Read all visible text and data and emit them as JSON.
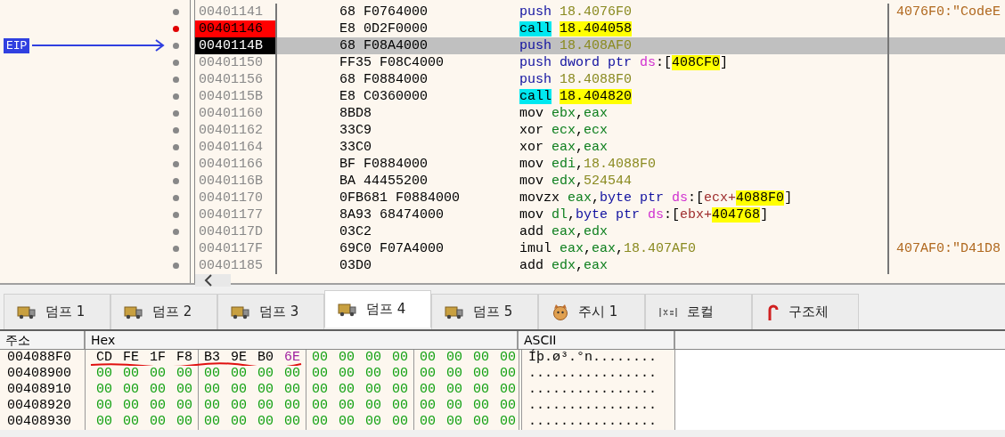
{
  "disassembly": {
    "eip_label": "EIP",
    "rows": [
      {
        "address": "00401141",
        "breakpoint": false,
        "current": false,
        "bytes": "68 F0764000",
        "instruction": [
          {
            "text": "push ",
            "kind": "stack"
          },
          {
            "text": "18.4076F0",
            "kind": "num"
          }
        ],
        "comment": "4076F0:\"CodeE"
      },
      {
        "address": "00401146",
        "breakpoint": true,
        "current": false,
        "bytes": "E8 0D2F0000",
        "instruction": [
          {
            "text": "call",
            "kind": "call"
          },
          {
            "text": "18.404058",
            "kind": "addr"
          }
        ]
      },
      {
        "address": "0040114B",
        "breakpoint": false,
        "current": true,
        "bytes": "68 F08A4000",
        "instruction": [
          {
            "text": "push ",
            "kind": "stack"
          },
          {
            "text": "18.408AF0",
            "kind": "num"
          }
        ]
      },
      {
        "address": "00401150",
        "breakpoint": false,
        "current": false,
        "bytes": "FF35 F08C4000",
        "instruction": [
          {
            "text": "push ",
            "kind": "stack"
          },
          {
            "text": "dword ptr ",
            "kind": "ptr"
          },
          {
            "text": "ds",
            "kind": "seg"
          },
          {
            "text": ":[",
            "kind": "punct"
          },
          {
            "text": "408CF0",
            "kind": "addr"
          },
          {
            "text": "]",
            "kind": "punct"
          }
        ]
      },
      {
        "address": "00401156",
        "breakpoint": false,
        "current": false,
        "bytes": "68 F0884000",
        "instruction": [
          {
            "text": "push ",
            "kind": "stack"
          },
          {
            "text": "18.4088F0",
            "kind": "num"
          }
        ]
      },
      {
        "address": "0040115B",
        "breakpoint": false,
        "current": false,
        "bytes": "E8 C0360000",
        "instruction": [
          {
            "text": "call",
            "kind": "call"
          },
          {
            "text": "18.404820",
            "kind": "addr"
          }
        ]
      },
      {
        "address": "00401160",
        "breakpoint": false,
        "current": false,
        "bytes": "8BD8",
        "instruction": [
          {
            "text": "mov ",
            "kind": "mnem"
          },
          {
            "text": "ebx",
            "kind": "reg"
          },
          {
            "text": ",",
            "kind": "punct"
          },
          {
            "text": "eax",
            "kind": "reg"
          }
        ]
      },
      {
        "address": "00401162",
        "breakpoint": false,
        "current": false,
        "bytes": "33C9",
        "instruction": [
          {
            "text": "xor ",
            "kind": "mnem"
          },
          {
            "text": "ecx",
            "kind": "reg"
          },
          {
            "text": ",",
            "kind": "punct"
          },
          {
            "text": "ecx",
            "kind": "reg"
          }
        ]
      },
      {
        "address": "00401164",
        "breakpoint": false,
        "current": false,
        "bytes": "33C0",
        "instruction": [
          {
            "text": "xor ",
            "kind": "mnem"
          },
          {
            "text": "eax",
            "kind": "reg"
          },
          {
            "text": ",",
            "kind": "punct"
          },
          {
            "text": "eax",
            "kind": "reg"
          }
        ]
      },
      {
        "address": "00401166",
        "breakpoint": false,
        "current": false,
        "bytes": "BF F0884000",
        "instruction": [
          {
            "text": "mov ",
            "kind": "mnem"
          },
          {
            "text": "edi",
            "kind": "reg"
          },
          {
            "text": ",",
            "kind": "punct"
          },
          {
            "text": "18.4088F0",
            "kind": "num"
          }
        ]
      },
      {
        "address": "0040116B",
        "breakpoint": false,
        "current": false,
        "bytes": "BA 44455200",
        "instruction": [
          {
            "text": "mov ",
            "kind": "mnem"
          },
          {
            "text": "edx",
            "kind": "reg"
          },
          {
            "text": ",",
            "kind": "punct"
          },
          {
            "text": "524544",
            "kind": "num"
          }
        ]
      },
      {
        "address": "00401170",
        "breakpoint": false,
        "current": false,
        "bytes": "0FB681 F0884000",
        "instruction": [
          {
            "text": "movzx ",
            "kind": "mnem"
          },
          {
            "text": "eax",
            "kind": "reg"
          },
          {
            "text": ",",
            "kind": "punct"
          },
          {
            "text": "byte ptr ",
            "kind": "ptr"
          },
          {
            "text": "ds",
            "kind": "seg"
          },
          {
            "text": ":[",
            "kind": "punct"
          },
          {
            "text": "ecx+",
            "kind": "memreg"
          },
          {
            "text": "4088F0",
            "kind": "addr"
          },
          {
            "text": "]",
            "kind": "punct"
          }
        ]
      },
      {
        "address": "00401177",
        "breakpoint": false,
        "current": false,
        "bytes": "8A93 68474000",
        "instruction": [
          {
            "text": "mov ",
            "kind": "mnem"
          },
          {
            "text": "dl",
            "kind": "reg"
          },
          {
            "text": ",",
            "kind": "punct"
          },
          {
            "text": "byte ptr ",
            "kind": "ptr"
          },
          {
            "text": "ds",
            "kind": "seg"
          },
          {
            "text": ":[",
            "kind": "punct"
          },
          {
            "text": "ebx+",
            "kind": "memreg"
          },
          {
            "text": "404768",
            "kind": "addr"
          },
          {
            "text": "]",
            "kind": "punct"
          }
        ]
      },
      {
        "address": "0040117D",
        "breakpoint": false,
        "current": false,
        "bytes": "03C2",
        "instruction": [
          {
            "text": "add ",
            "kind": "mnem"
          },
          {
            "text": "eax",
            "kind": "reg"
          },
          {
            "text": ",",
            "kind": "punct"
          },
          {
            "text": "edx",
            "kind": "reg"
          }
        ]
      },
      {
        "address": "0040117F",
        "breakpoint": false,
        "current": false,
        "bytes": "69C0 F07A4000",
        "instruction": [
          {
            "text": "imul ",
            "kind": "mnem"
          },
          {
            "text": "eax",
            "kind": "reg"
          },
          {
            "text": ",",
            "kind": "punct"
          },
          {
            "text": "eax",
            "kind": "reg"
          },
          {
            "text": ",",
            "kind": "punct"
          },
          {
            "text": "18.407AF0",
            "kind": "num"
          }
        ],
        "comment": "407AF0:\"D41D8"
      },
      {
        "address": "00401185",
        "breakpoint": false,
        "current": false,
        "bytes": "03D0",
        "instruction": [
          {
            "text": "add ",
            "kind": "mnem"
          },
          {
            "text": "edx",
            "kind": "reg"
          },
          {
            "text": ",",
            "kind": "punct"
          },
          {
            "text": "eax",
            "kind": "reg"
          }
        ]
      }
    ]
  },
  "tabs": [
    {
      "label": "덤프 1",
      "kind": "dump",
      "selected": false
    },
    {
      "label": "덤프 2",
      "kind": "dump",
      "selected": false
    },
    {
      "label": "덤프 3",
      "kind": "dump",
      "selected": false
    },
    {
      "label": "덤프 4",
      "kind": "dump",
      "selected": true
    },
    {
      "label": "덤프 5",
      "kind": "dump",
      "selected": false
    },
    {
      "label": "주시 1",
      "kind": "watch",
      "selected": false
    },
    {
      "label": "로컬",
      "kind": "locals",
      "selected": false
    },
    {
      "label": "구조체",
      "kind": "struct",
      "selected": false
    }
  ],
  "dump": {
    "columns": [
      "주소",
      "Hex",
      "ASCII"
    ],
    "annotation": {
      "kind": "underline"
    },
    "rows": [
      {
        "address": "004088F0",
        "ascii": "Íþ.ø³.°n........",
        "bytes": [
          {
            "text": "CD",
            "kind": "data"
          },
          {
            "text": "FE",
            "kind": "data"
          },
          {
            "text": "1F",
            "kind": "data"
          },
          {
            "text": "F8",
            "kind": "data"
          },
          {
            "text": "B3",
            "kind": "data"
          },
          {
            "text": "9E",
            "kind": "data"
          },
          {
            "text": "B0",
            "kind": "data"
          },
          {
            "text": "6E",
            "kind": "text"
          },
          {
            "text": "00",
            "kind": "zero"
          },
          {
            "text": "00",
            "kind": "zero"
          },
          {
            "text": "00",
            "kind": "zero"
          },
          {
            "text": "00",
            "kind": "zero"
          },
          {
            "text": "00",
            "kind": "zero"
          },
          {
            "text": "00",
            "kind": "zero"
          },
          {
            "text": "00",
            "kind": "zero"
          },
          {
            "text": "00",
            "kind": "zero"
          }
        ]
      },
      {
        "address": "00408900",
        "ascii": "................",
        "bytes": [
          {
            "text": "00",
            "kind": "zero"
          },
          {
            "text": "00",
            "kind": "zero"
          },
          {
            "text": "00",
            "kind": "zero"
          },
          {
            "text": "00",
            "kind": "zero"
          },
          {
            "text": "00",
            "kind": "zero"
          },
          {
            "text": "00",
            "kind": "zero"
          },
          {
            "text": "00",
            "kind": "zero"
          },
          {
            "text": "00",
            "kind": "zero"
          },
          {
            "text": "00",
            "kind": "zero"
          },
          {
            "text": "00",
            "kind": "zero"
          },
          {
            "text": "00",
            "kind": "zero"
          },
          {
            "text": "00",
            "kind": "zero"
          },
          {
            "text": "00",
            "kind": "zero"
          },
          {
            "text": "00",
            "kind": "zero"
          },
          {
            "text": "00",
            "kind": "zero"
          },
          {
            "text": "00",
            "kind": "zero"
          }
        ]
      },
      {
        "address": "00408910",
        "ascii": "................",
        "bytes": [
          {
            "text": "00",
            "kind": "zero"
          },
          {
            "text": "00",
            "kind": "zero"
          },
          {
            "text": "00",
            "kind": "zero"
          },
          {
            "text": "00",
            "kind": "zero"
          },
          {
            "text": "00",
            "kind": "zero"
          },
          {
            "text": "00",
            "kind": "zero"
          },
          {
            "text": "00",
            "kind": "zero"
          },
          {
            "text": "00",
            "kind": "zero"
          },
          {
            "text": "00",
            "kind": "zero"
          },
          {
            "text": "00",
            "kind": "zero"
          },
          {
            "text": "00",
            "kind": "zero"
          },
          {
            "text": "00",
            "kind": "zero"
          },
          {
            "text": "00",
            "kind": "zero"
          },
          {
            "text": "00",
            "kind": "zero"
          },
          {
            "text": "00",
            "kind": "zero"
          },
          {
            "text": "00",
            "kind": "zero"
          }
        ]
      },
      {
        "address": "00408920",
        "ascii": "................",
        "bytes": [
          {
            "text": "00",
            "kind": "zero"
          },
          {
            "text": "00",
            "kind": "zero"
          },
          {
            "text": "00",
            "kind": "zero"
          },
          {
            "text": "00",
            "kind": "zero"
          },
          {
            "text": "00",
            "kind": "zero"
          },
          {
            "text": "00",
            "kind": "zero"
          },
          {
            "text": "00",
            "kind": "zero"
          },
          {
            "text": "00",
            "kind": "zero"
          },
          {
            "text": "00",
            "kind": "zero"
          },
          {
            "text": "00",
            "kind": "zero"
          },
          {
            "text": "00",
            "kind": "zero"
          },
          {
            "text": "00",
            "kind": "zero"
          },
          {
            "text": "00",
            "kind": "zero"
          },
          {
            "text": "00",
            "kind": "zero"
          },
          {
            "text": "00",
            "kind": "zero"
          },
          {
            "text": "00",
            "kind": "zero"
          }
        ]
      },
      {
        "address": "00408930",
        "ascii": "................",
        "bytes": [
          {
            "text": "00",
            "kind": "zero"
          },
          {
            "text": "00",
            "kind": "zero"
          },
          {
            "text": "00",
            "kind": "zero"
          },
          {
            "text": "00",
            "kind": "zero"
          },
          {
            "text": "00",
            "kind": "zero"
          },
          {
            "text": "00",
            "kind": "zero"
          },
          {
            "text": "00",
            "kind": "zero"
          },
          {
            "text": "00",
            "kind": "zero"
          },
          {
            "text": "00",
            "kind": "zero"
          },
          {
            "text": "00",
            "kind": "zero"
          },
          {
            "text": "00",
            "kind": "zero"
          },
          {
            "text": "00",
            "kind": "zero"
          },
          {
            "text": "00",
            "kind": "zero"
          },
          {
            "text": "00",
            "kind": "zero"
          },
          {
            "text": "00",
            "kind": "zero"
          },
          {
            "text": "00",
            "kind": "zero"
          }
        ]
      }
    ]
  }
}
